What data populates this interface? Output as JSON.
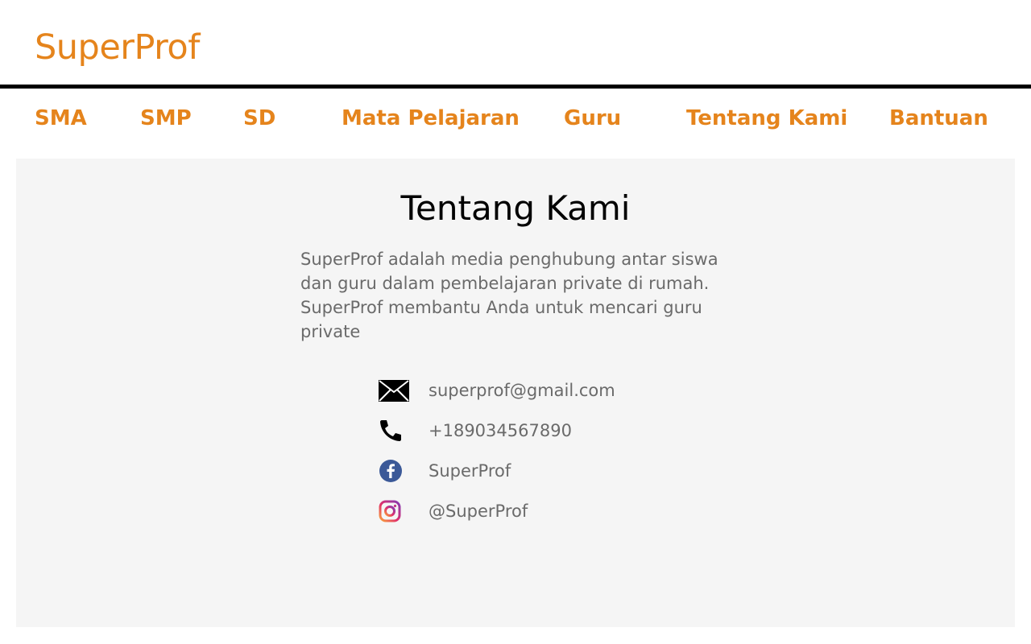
{
  "header": {
    "brand": "SuperProf"
  },
  "nav": {
    "items": [
      {
        "label": "SMA"
      },
      {
        "label": "SMP"
      },
      {
        "label": "SD"
      },
      {
        "label": "Mata Pelajaran"
      },
      {
        "label": "Guru"
      },
      {
        "label": "Tentang Kami"
      },
      {
        "label": "Bantuan"
      }
    ]
  },
  "about": {
    "title": "Tentang Kami",
    "description": "SuperProf adalah media penghubung antar siswa dan guru dalam pembelajaran private di rumah. SuperProf membantu Anda untuk mencari guru private"
  },
  "contacts": [
    {
      "icon": "envelope-icon",
      "text": "superprof@gmail.com"
    },
    {
      "icon": "phone-icon",
      "text": "+189034567890"
    },
    {
      "icon": "facebook-icon",
      "text": "SuperProf"
    },
    {
      "icon": "instagram-icon",
      "text": "@SuperProf"
    }
  ],
  "colors": {
    "accent": "#e5841c",
    "panel_bg": "#f5f5f5",
    "body_text": "#6a6a6a",
    "facebook": "#3b5998"
  }
}
